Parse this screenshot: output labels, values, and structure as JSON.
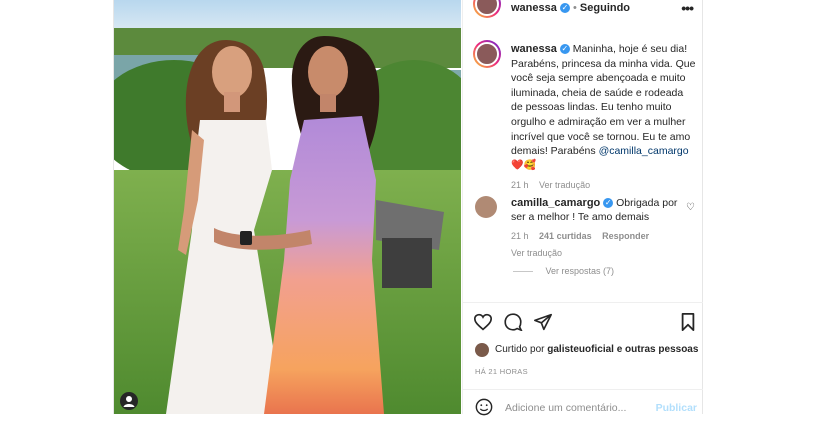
{
  "header": {
    "username": "wanessa",
    "separator": "•",
    "follow_status": "Seguindo",
    "more_icon": "more-horizontal-icon"
  },
  "caption": {
    "username": "wanessa",
    "text": "Maninha, hoje é seu dia! Parabéns, princesa da minha vida. Que você seja sempre abençoada e muito iluminada, cheia de saúde e rodeada de pessoas lindas. Eu tenho muito orgulho e admiração em ver a mulher incrível que você se tornou. Eu te amo demais! Parabéns",
    "mention": "@camilla_camargo",
    "emojis": "❤️🥰",
    "time": "21 h",
    "translate": "Ver tradução"
  },
  "reply": {
    "username": "camilla_camargo",
    "text": "Obrigada por ser a melhor ! Te amo demais",
    "time": "21 h",
    "likes": "241 curtidas",
    "respond": "Responder",
    "translate": "Ver tradução",
    "view_replies": "Ver respostas (7)"
  },
  "likes": {
    "prefix": "Curtido por",
    "user": "galisteuoficial",
    "suffix": "e outras pessoas"
  },
  "timestamp": "HÁ 21 HORAS",
  "comment_box": {
    "placeholder": "Adicione um comentário...",
    "publish": "Publicar"
  },
  "colors": {
    "verified": "#3897f0",
    "link": "#00376b",
    "publish_disabled": "#b2dffc"
  }
}
